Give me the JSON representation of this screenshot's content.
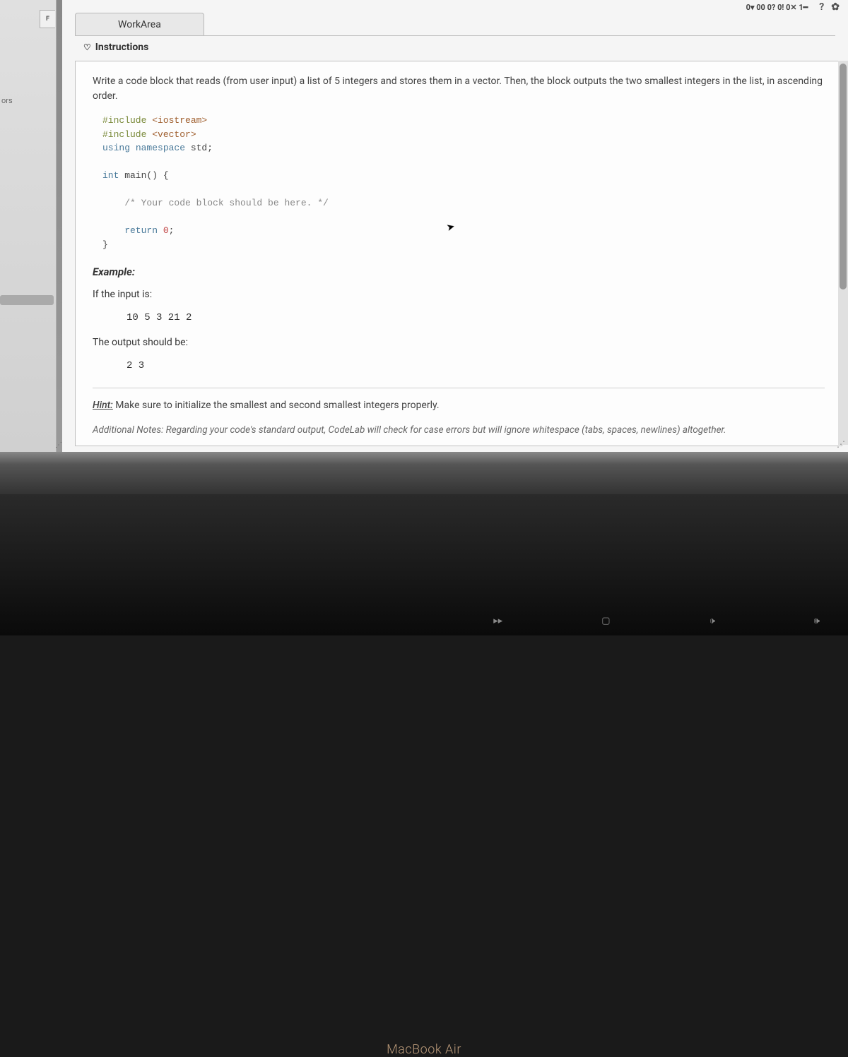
{
  "sidebar": {
    "tab_label": "F",
    "side_text": "ors"
  },
  "toolbar": {
    "indicators": "0▾  00  0?  0!  0✕  1━",
    "help": "?",
    "gear": "✿"
  },
  "tabs": {
    "workarea": "WorkArea"
  },
  "instructions": {
    "icon": "♡",
    "label": "Instructions"
  },
  "problem": {
    "statement": "Write a code block that reads (from user input) a list of 5 integers and stores them in a vector. Then, the block outputs the two smallest integers in the list, in ascending order."
  },
  "code": {
    "line1_a": "#include",
    "line1_b": " <iostream>",
    "line2_a": "#include",
    "line2_b": " <vector>",
    "line3_a": "using",
    "line3_b": " namespace",
    "line3_c": " std;",
    "line4_a": "int",
    "line4_b": " main() {",
    "line5": "    /* Your code block should be here. */",
    "line6_a": "    return",
    "line6_b": " 0",
    "line6_c": ";",
    "line7": "}"
  },
  "example": {
    "heading": "Example:",
    "input_label": "If the input is:",
    "input_value": "10 5 3 21 2",
    "output_label": "The output should be:",
    "output_value": "2 3"
  },
  "hint": {
    "label": "Hint:",
    "text": " Make sure to initialize the smallest and second smallest integers properly."
  },
  "notes": {
    "text": "Additional Notes: Regarding your code's standard output, CodeLab will check for case errors but will ignore whitespace (tabs, spaces, newlines) altogether."
  },
  "device": {
    "name": "MacBook Air"
  },
  "fnkeys": {
    "k1": "▸▸",
    "k2": "▢",
    "k3": "🕩",
    "k4": "🕪"
  }
}
